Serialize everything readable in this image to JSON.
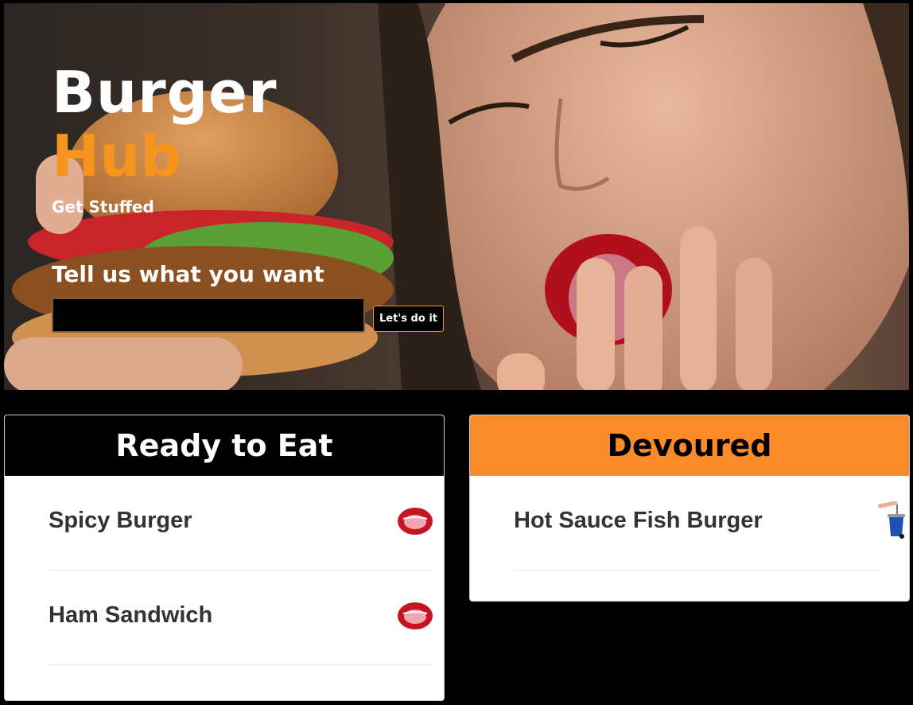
{
  "hero": {
    "brand_line1": "Burger",
    "brand_line2": "Hub",
    "tagline": "Get Stuffed",
    "prompt": "Tell us what you want",
    "input_value": "",
    "button_label": "Let's do it"
  },
  "ready": {
    "title": "Ready to Eat",
    "items": [
      {
        "label": "Spicy Burger",
        "icon": "lips-icon"
      },
      {
        "label": "Ham Sandwich",
        "icon": "lips-icon"
      }
    ]
  },
  "devoured": {
    "title": "Devoured",
    "items": [
      {
        "label": "Hot Sauce Fish Burger",
        "icon": "trash-can-icon"
      }
    ]
  },
  "colors": {
    "accent": "#f7941d",
    "devoured_header": "#fb8a28",
    "ready_header": "#000000"
  }
}
